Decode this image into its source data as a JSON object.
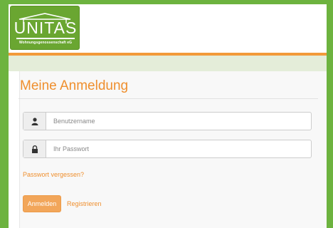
{
  "brand": {
    "name": "UNITAS",
    "tagline": "Wohnungsgenossenschaft eG"
  },
  "login": {
    "title": "Meine Anmeldung",
    "username_placeholder": "Benutzername",
    "password_placeholder": "Ihr Passwort",
    "forgot_link": "Passwort vergessen?",
    "login_button": "Anmelden",
    "register_link": "Registrieren"
  },
  "icons": {
    "username": "user-icon",
    "password": "lock-icon"
  },
  "colors": {
    "page_bg": "#6db33f",
    "logo_bg": "#6aa631",
    "accent": "#ef8f2e",
    "button_bg": "#f2a65a",
    "band_bg": "#e4edd9"
  }
}
